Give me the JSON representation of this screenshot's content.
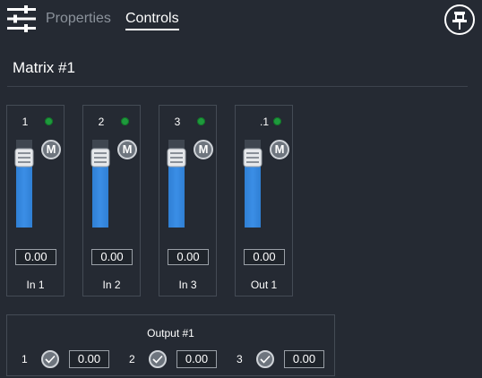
{
  "tabs": [
    {
      "label": "Properties",
      "selected": false
    },
    {
      "label": "Controls",
      "selected": true
    }
  ],
  "icons": {
    "settings": "sliders-icon",
    "pin": "pin-icon",
    "mute": "mute-icon",
    "route": "checkmark-icon"
  },
  "colors": {
    "background": "#252a33",
    "fader_fill": "#3b8ee6",
    "led_on": "#1e9a3c",
    "inactive_tab": "#8b929b"
  },
  "matrix": {
    "title": "Matrix #1",
    "channels": [
      {
        "number": "1",
        "label": "In 1",
        "gain": "0.00",
        "mute_label": "M",
        "led": "on"
      },
      {
        "number": "2",
        "label": "In 2",
        "gain": "0.00",
        "mute_label": "M",
        "led": "on"
      },
      {
        "number": "3",
        "label": "In 3",
        "gain": "0.00",
        "mute_label": "M",
        "led": "on"
      },
      {
        "number": ".1",
        "label": "Out 1",
        "gain": "0.00",
        "mute_label": "M",
        "led": "on"
      }
    ]
  },
  "output": {
    "title": "Output #1",
    "routes": [
      {
        "number": "1",
        "enabled": true,
        "gain": "0.00"
      },
      {
        "number": "2",
        "enabled": true,
        "gain": "0.00"
      },
      {
        "number": "3",
        "enabled": true,
        "gain": "0.00"
      }
    ]
  }
}
